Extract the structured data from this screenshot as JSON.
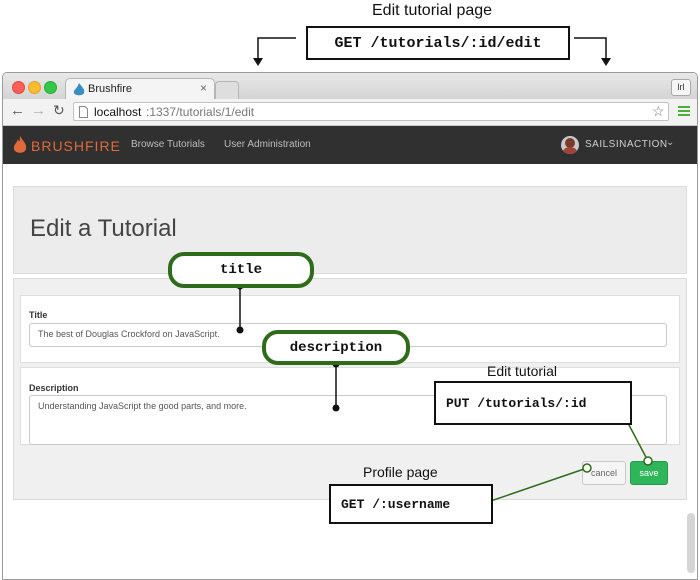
{
  "annotations": {
    "top_title": "Edit tutorial page",
    "top_route": "GET /tutorials/:id/edit",
    "title_pill": "title",
    "description_pill": "description",
    "edit_label": "Edit tutorial",
    "edit_route": "PUT /tutorials/:id",
    "profile_label": "Profile page",
    "profile_route": "GET /:username"
  },
  "browser": {
    "tab_title": "Brushfire",
    "url_host": "localhost",
    "url_path": ":1337/tutorials/1/edit",
    "user_badge": "lrl"
  },
  "navbar": {
    "brand": "BRUSHFIRE",
    "links": [
      "Browse Tutorials",
      "User Administration"
    ],
    "username": "SAILSINACTION"
  },
  "page": {
    "heading": "Edit a Tutorial",
    "title_label": "Title",
    "title_value": "The best of Douglas Crockford on JavaScript.",
    "description_label": "Description",
    "description_value": "Understanding JavaScript the good parts, and more.",
    "cancel_label": "cancel",
    "save_label": "save"
  },
  "colors": {
    "brand_orange": "#e06a3b",
    "navbar": "#303030",
    "annotation_green": "#2e6b1a",
    "save_green": "#2fb55a"
  }
}
